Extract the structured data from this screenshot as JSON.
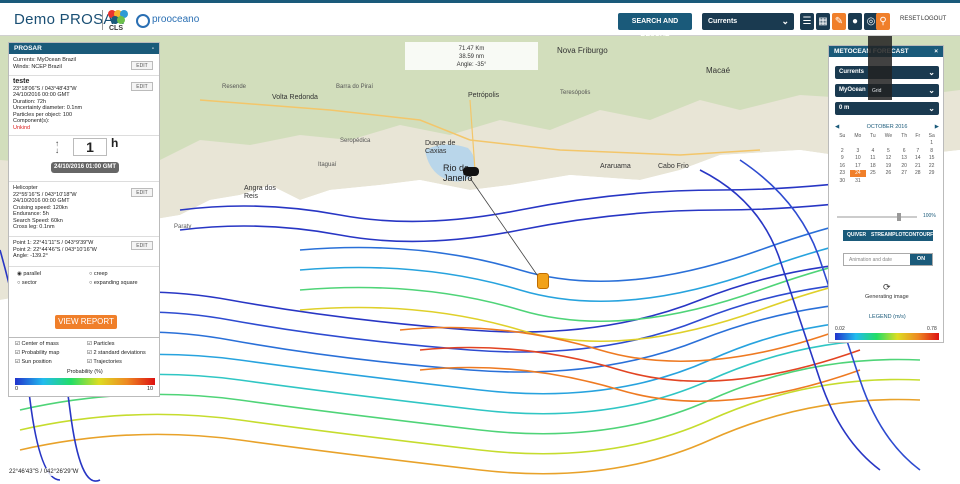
{
  "header": {
    "brand": "Demo PROSAR",
    "cls_logo_text": "CLS",
    "prooceano_text": "prooceano",
    "search_rescue_label": "SEARCH AND RESCUE",
    "layer_select_value": "Currents",
    "reset_label": "RESET",
    "logout_label": "LOGOUT"
  },
  "map": {
    "labels": {
      "cabo_frio": "Cabo Frio",
      "nova_friburgo": "Nova Friburgo",
      "macae": "Macaé",
      "volta_redonda": "Volta Redonda",
      "petropolis": "Petrópolis",
      "duque_de_caxias": "Duque de Caxias",
      "rio_de_janeiro": "Rio de Janeiro",
      "angra_dos_reis": "Angra dos Reis",
      "araruama": "Araruama",
      "resende": "Resende",
      "barra_do_pirai": "Barra do Piraí",
      "teresopolis": "Teresópolis",
      "itaguai": "Itaguaí",
      "serrapedica": "Seropédica",
      "paraty": "Paraty"
    },
    "measure_overlay": {
      "distance": "71.47 Km",
      "nm": "38.59 nm",
      "angle": "Angle: -35°"
    },
    "coordinate_readout": "22°46'43\"S / 042°26'29\"W"
  },
  "left_panel": {
    "title": "PROSAR",
    "minimize": "-",
    "currents_label": "Currents: MyOcean Brazil",
    "winds_label": "Winds: NCEP Brazil",
    "edit_label": "EDIT",
    "object": {
      "name": "teste",
      "coords": "23°18'06\"S / 043°48'43\"W",
      "datetime": "24/10/2016 00:00 GMT",
      "duration": "Duration: 72h",
      "uncertainty": "Uncertainty diameter: 0.1nm",
      "particles": "Particles per object: 100",
      "components": "Component(s):",
      "component_name": "Unkind"
    },
    "time_stepper": {
      "value": "1",
      "unit": "h",
      "datetime": "24/10/2016 01:00 GMT"
    },
    "helicopter": {
      "name": "Helicopter",
      "coords": "22°55'16\"S / 043°10'18\"W",
      "datetime": "24/10/2016 00:00 GMT",
      "speed": "Cruising speed: 120kn",
      "endurance": "Endurance: 5h",
      "search_speed": "Search Speed: 60kn",
      "cross_leg": "Cross leg: 0.1nm"
    },
    "route": {
      "point_a": "Point 1: 22°41'11\"S / 043°9'39\"W",
      "point_b": "Point 2: 22°44'46\"S / 043°10'16\"W",
      "angle": "Angle: -139.2°"
    },
    "patterns": {
      "parallel": "parallel",
      "creep": "creep",
      "sector": "sector",
      "expanding_square": "expanding square"
    },
    "view_report_label": "VIEW REPORT"
  },
  "lower_panel": {
    "center_of_mass": "Center of mass",
    "particles": "Particles",
    "probability_map": "Probability map",
    "std_dev": "2 standard deviations",
    "sun_position": "Sun position",
    "trajectories": "Trajectories",
    "probability_title": "Probability (%)",
    "scale_min": "0",
    "scale_max": "10"
  },
  "right_panel": {
    "title": "METOCEAN FORECAST",
    "close": "×",
    "select_layer": "Currents",
    "select_source": "MyOcean",
    "select_depth": "0 m",
    "calendar": {
      "month_label": "OCTOBER 2016",
      "weekdays": [
        "Su",
        "Mo",
        "Tu",
        "We",
        "Th",
        "Fr",
        "Sa"
      ],
      "weeks": [
        [
          "",
          "",
          "",
          "",
          "",
          "",
          "1"
        ],
        [
          "2",
          "3",
          "4",
          "5",
          "6",
          "7",
          "8"
        ],
        [
          "9",
          "10",
          "11",
          "12",
          "13",
          "14",
          "15"
        ],
        [
          "16",
          "17",
          "18",
          "19",
          "20",
          "21",
          "22"
        ],
        [
          "23",
          "24",
          "25",
          "26",
          "27",
          "28",
          "29"
        ],
        [
          "30",
          "31",
          "",
          "",
          "",
          "",
          ""
        ]
      ],
      "selected": "24"
    },
    "opacity_value": "100%",
    "viz_buttons": [
      "QUIVER",
      "STREAMPLOT",
      "CONTOURF"
    ],
    "animation_placeholder": "Animation and date",
    "animation_toggle": "ON",
    "generating_label": "Generating image",
    "legend_title": "LEGEND (m/s)",
    "legend_min": "0.02",
    "legend_max": "0.78"
  },
  "tooltip": {
    "label": "Grid"
  },
  "colors": {
    "primary": "#1a5a7a",
    "accent": "#f07f2a",
    "dark": "#1a3a50"
  }
}
